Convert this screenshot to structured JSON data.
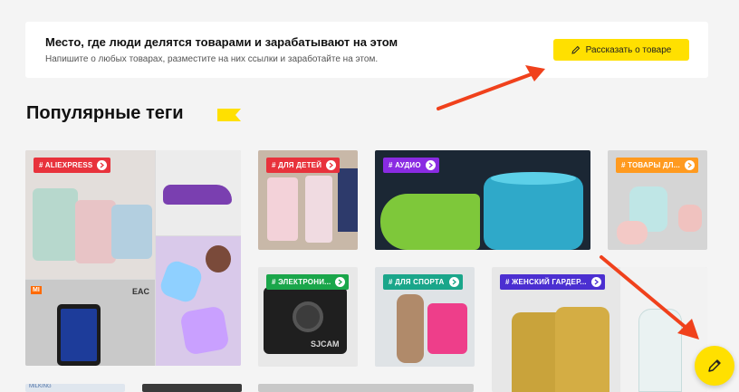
{
  "banner": {
    "title": "Место, где люди делятся товарами и зарабатывают на этом",
    "subtitle": "Напишите о любых товарах, разместите на них ссылки и заработайте на этом.",
    "button_label": "Рассказать о товаре"
  },
  "section": {
    "title": "Популярные теги"
  },
  "tags": [
    {
      "label": "# ALIEXPRESS",
      "color": "#e8323c"
    },
    {
      "label": "# ДЛЯ ДЕТЕЙ",
      "color": "#e8323c"
    },
    {
      "label": "# АУДИО",
      "color": "#8a2be2"
    },
    {
      "label": "# ТОВАРЫ ДЛ...",
      "color": "#ff9a1f"
    },
    {
      "label": "# ЭЛЕКТРОНИ...",
      "color": "#1aa64a"
    },
    {
      "label": "# ДЛЯ СПОРТА",
      "color": "#1aa68a"
    },
    {
      "label": "# ЖЕНСКИЙ ГАРДЕР...",
      "color": "#4b2fd1"
    }
  ],
  "product_texts": {
    "camera_brand": "SJCAM",
    "eac_mark": "EAC",
    "mi_logo": "MI",
    "bottom_partial": "MILKING"
  },
  "colors": {
    "accent": "#ffe000",
    "annotation_arrow": "#f0411c"
  },
  "icons": {
    "button_icon": "pencil-icon",
    "fab_icon": "pencil-icon",
    "tag_icon": "chevron-right-icon",
    "title_decoration": "yellow-flag-icon"
  }
}
